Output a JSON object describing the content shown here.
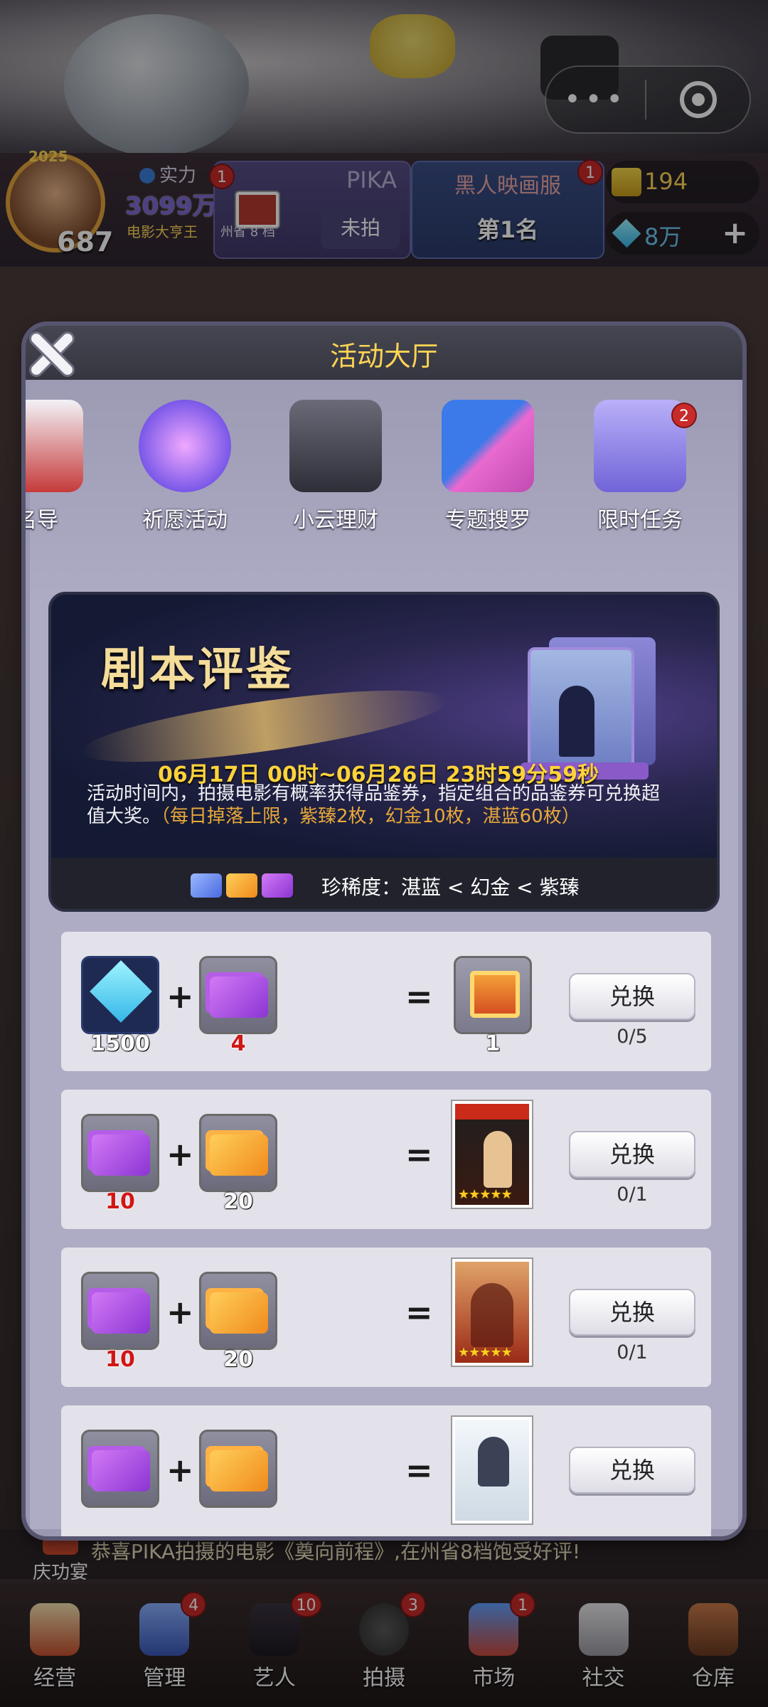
{
  "hud": {
    "level": "687",
    "avatar_badge": "2025",
    "power_label": "实力",
    "power_value": "3099万",
    "power_sub": "电影大亨王",
    "film": {
      "name": "PIKA",
      "location": "州省 8 档",
      "status": "未拍",
      "badge": "1"
    },
    "rank": {
      "title": "黑人映画服",
      "value": "第1名",
      "badge": "1"
    },
    "gold": "194",
    "diamonds": "8万",
    "plus": "+"
  },
  "panel": {
    "title": "活动大厅",
    "activities": [
      {
        "label": "名导",
        "icon": "director-icon"
      },
      {
        "label": "祈愿活动",
        "icon": "wish-star-icon"
      },
      {
        "label": "小云理财",
        "icon": "safe-icon"
      },
      {
        "label": "专题搜罗",
        "icon": "books-icon"
      },
      {
        "label": "限时任务",
        "icon": "clipboard-icon",
        "badge": "2"
      }
    ],
    "banner": {
      "title": "剧本评鉴",
      "time": "06月17日 00时~06月26日 23时59分59秒",
      "desc_main": "活动时间内，拍摄电影有概率获得品鉴券，指定组合的品鉴券可兑换超值大奖。",
      "desc_highlight": "（每日掉落上限，紫臻2枚，幻金10枚，湛蓝60枚）",
      "rarity": "珍稀度：湛蓝 < 幻金 < 紫臻"
    },
    "exchanges": [
      {
        "input1_qty": "1500",
        "input2_qty": "4",
        "output_qty": "1",
        "button": "兑换",
        "count": "0/5"
      },
      {
        "input1_qty": "10",
        "input2_qty": "20",
        "output_stars": "★★★★★",
        "button": "兑换",
        "count": "0/1"
      },
      {
        "input1_qty": "10",
        "input2_qty": "20",
        "output_stars": "★★★★★",
        "button": "兑换",
        "count": "0/1"
      },
      {
        "button": "兑换"
      }
    ],
    "plus_sign": "+",
    "equals_sign": "="
  },
  "side": {
    "ticker": "恭喜PIKA拍摄的电影《奠向前程》,在州省8档饱受好评!",
    "celebrate": "庆功宴"
  },
  "nav": [
    {
      "label": "经营",
      "badge": ""
    },
    {
      "label": "管理",
      "badge": "4"
    },
    {
      "label": "艺人",
      "badge": "10"
    },
    {
      "label": "拍摄",
      "badge": "3"
    },
    {
      "label": "市场",
      "badge": "1"
    },
    {
      "label": "社交",
      "badge": ""
    },
    {
      "label": "仓库",
      "badge": ""
    }
  ],
  "colors": {
    "title_gold": "#ffd454",
    "banner_time": "#ffd33a",
    "qty_red": "#d11616",
    "panel_bg": "#aeacc4"
  }
}
